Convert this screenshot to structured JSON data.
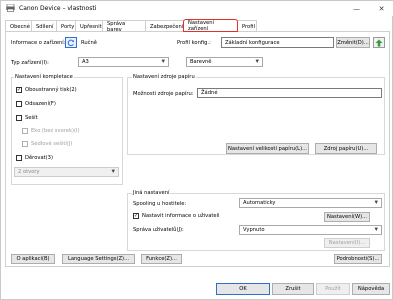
{
  "window": {
    "title": "Canon Device – vlastnosti",
    "minimize": "—",
    "close": "✕"
  },
  "tabs": [
    {
      "label": "Obecné"
    },
    {
      "label": "Sdílení"
    },
    {
      "label": "Porty"
    },
    {
      "label": "Upřesnit"
    },
    {
      "label": "Správa barev"
    },
    {
      "label": "Zabezpečení"
    },
    {
      "label": "Nastavení zařízení"
    },
    {
      "label": "Profil"
    }
  ],
  "device_info": {
    "label": "Informace o zařízení:",
    "mode": "Ručně"
  },
  "profile": {
    "label": "Profil konfig.:",
    "value": "Základní konfigurace",
    "change_button": "Změnit(D)..."
  },
  "device_type": {
    "label": "Typ zařízení(I):",
    "value": "A3",
    "color_value": "Barevně"
  },
  "finishing": {
    "title": "Nastavení kompletace",
    "duplex": "Oboustranný tisk(2)",
    "offset": "Odsazení(F)",
    "staple": "Sešít",
    "saddle": "Eko (bez svorek)(I)",
    "saddle_stitch": "Sedlové sešití(J)",
    "punch": "Děrovat(3)",
    "punch_select": "2 otvory"
  },
  "paper_source": {
    "title": "Nastavení zdroje papíru",
    "option_label": "Možnosti zdroje papíru:",
    "option_value": "Žádné",
    "size_button": "Nastavení velikosti papíru(L)...",
    "source_button": "Zdroj papíru(U)..."
  },
  "other": {
    "title": "Jiná nastavení",
    "spooling_label": "Spooling u hostitele:",
    "spooling_value": "Automaticky",
    "device_info_checkbox": "Nastavit informace o uživateli",
    "settings_button": "Nastavení(W)...",
    "user_mgmt_label": "Správa uživatelů(J):",
    "user_mgmt_value": "Vypnuto",
    "settings2_button": "Nastavení(I)..."
  },
  "bottom_buttons": {
    "about": "O aplikaci(B)",
    "language": "Language Settings(Z)...",
    "functions": "Funkce(Z)...",
    "details": "Podrobnosti(S)..."
  },
  "dialog_buttons": {
    "ok": "OK",
    "cancel": "Zrušit",
    "apply": "Použít",
    "help": "Nápověda"
  },
  "colors": {
    "active_tab_border": "#e0312b",
    "refresh_icon": "#2f6fd1",
    "update_icon": "#3a9a3a"
  }
}
